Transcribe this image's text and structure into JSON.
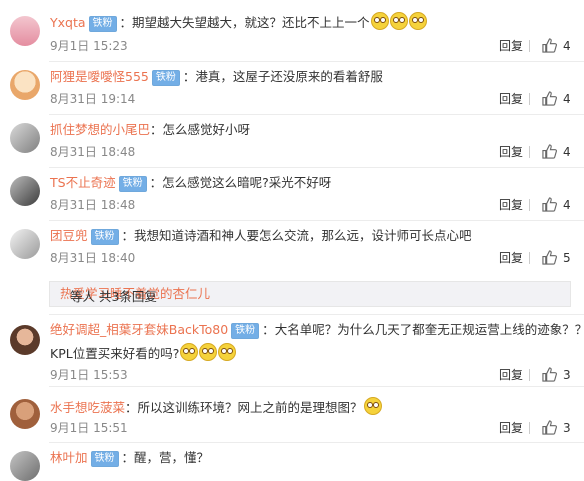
{
  "labels": {
    "badge": "铁粉",
    "reply": "回复",
    "colon": "："
  },
  "comments": [
    {
      "user": "Yxqta",
      "text": "期望越大失望越大，就这？还比不上上一个",
      "emoji_count": 3,
      "time": "9月1日 15:23",
      "likes": "4"
    },
    {
      "user": "阿狸是噯噯怪555",
      "text": "港真，这屋子还没原来的看着舒服",
      "time": "8月31日 19:14",
      "likes": "4"
    },
    {
      "user": "抓住梦想的小尾巴",
      "text": "怎么感觉好小呀",
      "time": "8月31日 18:48",
      "likes": "4"
    },
    {
      "user": "TS不止奇迹",
      "text": "怎么感觉这么暗呢?采光不好呀",
      "time": "8月31日 18:48",
      "likes": "4"
    },
    {
      "user": "团豆兜",
      "text": "我想知道诗酒和神人要怎么交流，那么远，设计师可长点心吧",
      "time": "8月31日 18:40",
      "likes": "5"
    },
    {
      "user": "绝好调超_相葉牙套妹BackTo80",
      "text": "大名单呢？为什么几天了都奎无正规运营上线的迹象？？",
      "text2": "KPL位置买来好看的吗?",
      "emoji_count": 3,
      "time": "9月1日 15:53",
      "likes": "3"
    },
    {
      "user": "水手想吃菠菜",
      "text": "所以这训练环境？网上之前的是理想图？",
      "emoji_count": 1,
      "time": "9月1日 15:51",
      "likes": "3"
    },
    {
      "user": "林叶加",
      "text": "醒，营，懂？"
    }
  ],
  "subreply": {
    "user": "热爱学习睡不着觉的杏仁儿",
    "text": " 等人 共3条回复"
  },
  "colors": {
    "username": "#eb7350",
    "badge": "#73aee6",
    "meta": "#888888"
  },
  "icons": [
    "like-thumb-icon",
    "emoji-face-icon"
  ]
}
